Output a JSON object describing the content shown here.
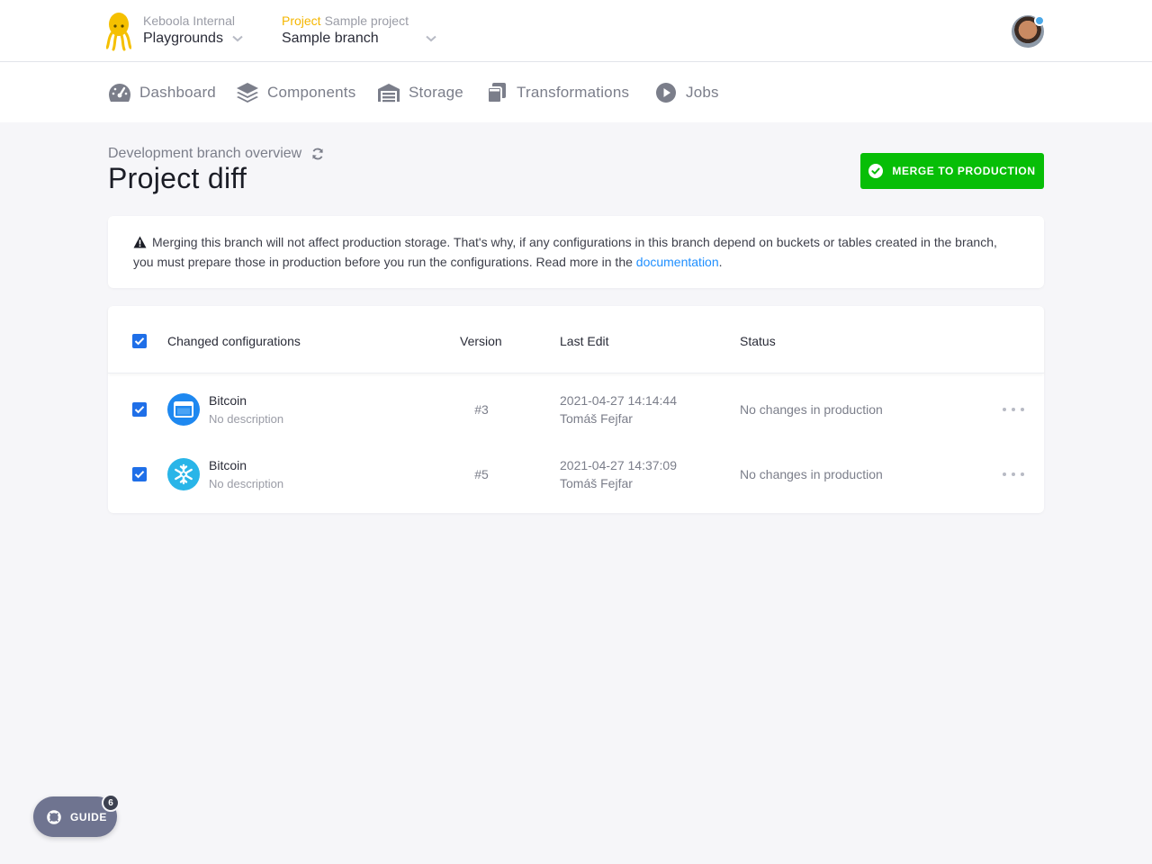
{
  "header": {
    "org_caption": "Keboola Internal",
    "org_name": "Playgrounds",
    "project_label": "Project",
    "project_name": "Sample project",
    "branch_name": "Sample branch"
  },
  "nav": {
    "items": [
      {
        "label": "Dashboard",
        "icon": "dashboard-icon"
      },
      {
        "label": "Components",
        "icon": "layers-icon"
      },
      {
        "label": "Storage",
        "icon": "warehouse-icon"
      },
      {
        "label": "Transformations",
        "icon": "copy-icon"
      },
      {
        "label": "Jobs",
        "icon": "play-icon"
      }
    ]
  },
  "page": {
    "pre_title": "Development branch overview",
    "title": "Project diff",
    "merge_button": "MERGE TO PRODUCTION"
  },
  "notice": {
    "text": "Merging this branch will not affect production storage. That's why, if any configurations in this branch depend on buckets or tables created in the branch, you must prepare those in production before you run the configurations. Read more in the",
    "link": "documentation",
    "end": "."
  },
  "table": {
    "headers": {
      "config": "Changed configurations",
      "version": "Version",
      "last_edit": "Last Edit",
      "status": "Status"
    },
    "rows": [
      {
        "name": "Bitcoin",
        "description": "No description",
        "version": "#3",
        "date": "2021-04-27 14:14:44",
        "author": "Tomáš Fejfar",
        "status": "No changes in production",
        "icon": "window-icon"
      },
      {
        "name": "Bitcoin",
        "description": "No description",
        "version": "#5",
        "date": "2021-04-27 14:37:09",
        "author": "Tomáš Fejfar",
        "status": "No changes in production",
        "icon": "snowflake-icon"
      }
    ]
  },
  "guide": {
    "label": "GUIDE",
    "count": "6"
  },
  "colors": {
    "accent_green": "#07be07",
    "link_blue": "#1f8fff",
    "checkbox_blue": "#1f6fe8",
    "project_yellow": "#f5b600"
  }
}
